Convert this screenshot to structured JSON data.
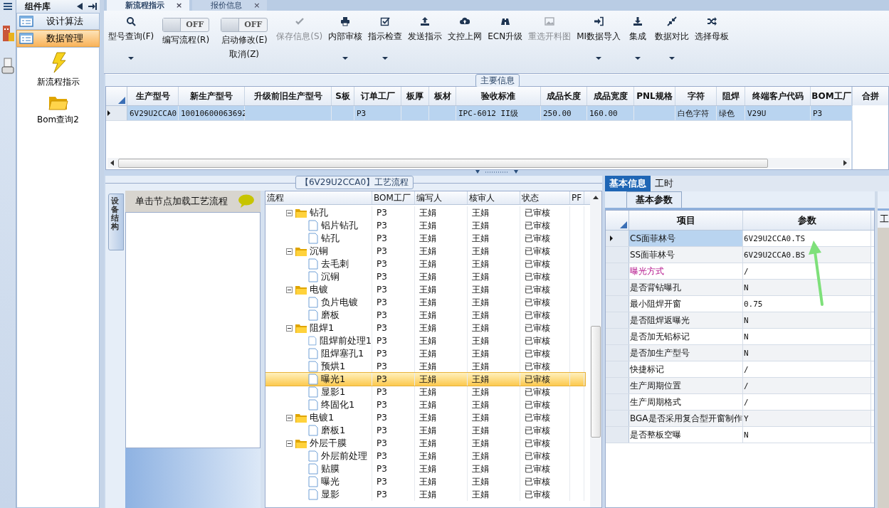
{
  "sidebar": {
    "title": "组件库",
    "items": [
      {
        "label": "设计算法",
        "selected": false
      },
      {
        "label": "数据管理",
        "selected": true
      }
    ],
    "tools": [
      {
        "label": "新流程指示"
      },
      {
        "label": "Bom查询2"
      }
    ]
  },
  "tabs": [
    {
      "label": "新流程指示",
      "selected": true,
      "close": "×"
    },
    {
      "label": "报价信息",
      "selected": false,
      "close": "×"
    }
  ],
  "toolbar": [
    {
      "kind": "button",
      "label": "型号查询(F)",
      "dropdown": true,
      "disabled": false
    },
    {
      "kind": "toggle",
      "state_text": "OFF",
      "on": false,
      "label": "编写流程(R)"
    },
    {
      "kind": "toggle",
      "state_text": "OFF",
      "on": false,
      "label": "启动修改(E)",
      "label2": "取消(Z)"
    },
    {
      "kind": "button",
      "label": "保存信息(S)",
      "dropdown": false,
      "disabled": true
    },
    {
      "kind": "button",
      "label": "内部审核",
      "dropdown": true,
      "disabled": false
    },
    {
      "kind": "button",
      "label": "指示检查",
      "dropdown": true,
      "disabled": false
    },
    {
      "kind": "button",
      "label": "发送指示",
      "dropdown": false,
      "disabled": false
    },
    {
      "kind": "button",
      "label": "文控上网",
      "dropdown": false,
      "disabled": false
    },
    {
      "kind": "button",
      "label": "ECN升级",
      "dropdown": false,
      "disabled": false
    },
    {
      "kind": "button",
      "label": "重选开料图",
      "dropdown": false,
      "disabled": true
    },
    {
      "kind": "button",
      "label": "MI数据导入",
      "dropdown": true,
      "disabled": false
    },
    {
      "kind": "button",
      "label": "集成",
      "dropdown": true,
      "disabled": false
    },
    {
      "kind": "button",
      "label": "数据对比",
      "dropdown": true,
      "disabled": false
    },
    {
      "kind": "button",
      "label": "选择母板",
      "dropdown": false,
      "disabled": false
    }
  ],
  "main_info": {
    "title": "主要信息",
    "columns": [
      "生产型号",
      "新生产型号",
      "升级前旧生产型号",
      "S板",
      "订单工厂",
      "板厚",
      "板材",
      "验收标准",
      "成品长度",
      "成品宽度",
      "PNL规格",
      "字符",
      "阻焊",
      "终端客户代码",
      "BOM工厂"
    ],
    "rows": [
      {
        "selected": true,
        "cells": [
          "6V29U2CCA0",
          "10010600063692",
          null,
          null,
          "P3",
          null,
          null,
          "IPC-6012 II级",
          "250.00",
          "160.00",
          null,
          "白色字符",
          "绿色",
          "V29U",
          "P3"
        ]
      }
    ],
    "side_column": "合拼"
  },
  "process": {
    "title": "【6V29U2CCA0】工艺流程",
    "side_tab": "设备结构",
    "hint": "单击节点加载工艺流程",
    "columns": [
      "流程",
      "BOM工厂",
      "编写人",
      "核审人",
      "状态",
      "PF"
    ],
    "nodes": [
      {
        "name": "钻孔",
        "bom": "P3",
        "writer": "王娟",
        "reviewer": "王娟",
        "status": "已审核",
        "selected": false,
        "children": [
          {
            "name": "铝片钻孔",
            "bom": "P3",
            "writer": "王娟",
            "reviewer": "王娟",
            "status": "已审核",
            "selected": false
          },
          {
            "name": "钻孔",
            "bom": "P3",
            "writer": "王娟",
            "reviewer": "王娟",
            "status": "已审核",
            "selected": false
          }
        ]
      },
      {
        "name": "沉铜",
        "bom": "P3",
        "writer": "王娟",
        "reviewer": "王娟",
        "status": "已审核",
        "selected": false,
        "children": [
          {
            "name": "去毛刺",
            "bom": "P3",
            "writer": "王娟",
            "reviewer": "王娟",
            "status": "已审核",
            "selected": false
          },
          {
            "name": "沉铜",
            "bom": "P3",
            "writer": "王娟",
            "reviewer": "王娟",
            "status": "已审核",
            "selected": false
          }
        ]
      },
      {
        "name": "电镀",
        "bom": "P3",
        "writer": "王娟",
        "reviewer": "王娟",
        "status": "已审核",
        "selected": false,
        "children": [
          {
            "name": "负片电镀",
            "bom": "P3",
            "writer": "王娟",
            "reviewer": "王娟",
            "status": "已审核",
            "selected": false
          },
          {
            "name": "磨板",
            "bom": "P3",
            "writer": "王娟",
            "reviewer": "王娟",
            "status": "已审核",
            "selected": false
          }
        ]
      },
      {
        "name": "阻焊1",
        "bom": "P3",
        "writer": "王娟",
        "reviewer": "王娟",
        "status": "已审核",
        "selected": false,
        "children": [
          {
            "name": "阻焊前处理1",
            "bom": "P3",
            "writer": "王娟",
            "reviewer": "王娟",
            "status": "已审核",
            "selected": false
          },
          {
            "name": "阻焊塞孔1",
            "bom": "P3",
            "writer": "王娟",
            "reviewer": "王娟",
            "status": "已审核",
            "selected": false
          },
          {
            "name": "预烘1",
            "bom": "P3",
            "writer": "王娟",
            "reviewer": "王娟",
            "status": "已审核",
            "selected": false
          },
          {
            "name": "曝光1",
            "bom": "P3",
            "writer": "王娟",
            "reviewer": "王娟",
            "status": "已审核",
            "selected": true
          },
          {
            "name": "显影1",
            "bom": "P3",
            "writer": "王娟",
            "reviewer": "王娟",
            "status": "已审核",
            "selected": false
          },
          {
            "name": "终固化1",
            "bom": "P3",
            "writer": "王娟",
            "reviewer": "王娟",
            "status": "已审核",
            "selected": false
          }
        ]
      },
      {
        "name": "电镀1",
        "bom": "P3",
        "writer": "王娟",
        "reviewer": "王娟",
        "status": "已审核",
        "selected": false,
        "children": [
          {
            "name": "磨板1",
            "bom": "P3",
            "writer": "王娟",
            "reviewer": "王娟",
            "status": "已审核",
            "selected": false
          }
        ]
      },
      {
        "name": "外层干膜",
        "bom": "P3",
        "writer": "王娟",
        "reviewer": "王娟",
        "status": "已审核",
        "selected": false,
        "children": [
          {
            "name": "外层前处理",
            "bom": "P3",
            "writer": "王娟",
            "reviewer": "王娟",
            "status": "已审核",
            "selected": false
          },
          {
            "name": "贴膜",
            "bom": "P3",
            "writer": "王娟",
            "reviewer": "王娟",
            "status": "已审核",
            "selected": false
          },
          {
            "name": "曝光",
            "bom": "P3",
            "writer": "王娟",
            "reviewer": "王娟",
            "status": "已审核",
            "selected": false
          },
          {
            "name": "显影",
            "bom": "P3",
            "writer": "王娟",
            "reviewer": "王娟",
            "status": "已审核",
            "selected": false
          }
        ]
      }
    ]
  },
  "details": {
    "tabs": [
      {
        "label": "基本信息",
        "selected": true
      },
      {
        "label": "工时",
        "selected": false
      }
    ],
    "subtab": "基本参数",
    "columns": [
      "项目",
      "参数"
    ],
    "rows": [
      {
        "item": "CS面菲林号",
        "value": "6V29U2CCA0.TS",
        "selected": true,
        "flagged": false
      },
      {
        "item": "SS面菲林号",
        "value": "6V29U2CCA0.BS",
        "selected": false,
        "flagged": false
      },
      {
        "item": "曝光方式",
        "value": "/",
        "selected": false,
        "flagged": true
      },
      {
        "item": "是否背钻曝孔",
        "value": "N",
        "selected": false,
        "flagged": false
      },
      {
        "item": "最小阻焊开窗",
        "value": "0.75",
        "selected": false,
        "flagged": false
      },
      {
        "item": "是否阻焊返曝光",
        "value": "N",
        "selected": false,
        "flagged": false
      },
      {
        "item": "是否加无铅标记",
        "value": "N",
        "selected": false,
        "flagged": false
      },
      {
        "item": "是否加生产型号",
        "value": "N",
        "selected": false,
        "flagged": false
      },
      {
        "item": "快捷标记",
        "value": "/",
        "selected": false,
        "flagged": false
      },
      {
        "item": "生产周期位置",
        "value": "/",
        "selected": false,
        "flagged": false
      },
      {
        "item": "生产周期格式",
        "value": "/",
        "selected": false,
        "flagged": false
      },
      {
        "item": "BGA是否采用复合型开窗制作",
        "value": "Y",
        "selected": false,
        "flagged": false
      },
      {
        "item": "是否整板空曝",
        "value": "N",
        "selected": false,
        "flagged": false
      }
    ],
    "side_label": "工"
  }
}
